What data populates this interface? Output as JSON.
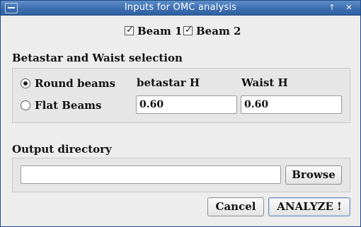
{
  "window": {
    "title": "Inputs for OMC analysis",
    "title_buttons": {
      "menu": "window-menu-icon",
      "up": "↑",
      "close": "✕"
    }
  },
  "beams": {
    "beam1": {
      "label": "Beam 1",
      "checked": true
    },
    "beam2": {
      "label": "Beam 2",
      "checked": true
    },
    "check_glyph": "✓"
  },
  "betastar_section": {
    "title": "Betastar and Waist selection",
    "round_label": "Round beams",
    "flat_label": "Flat Beams",
    "selected": "round",
    "betastar_head": "betastar H",
    "waist_head": "Waist H",
    "betastar_value": "0.60",
    "waist_value": "0.60"
  },
  "output_section": {
    "title": "Output directory",
    "path_value": "",
    "browse_label": "Browse"
  },
  "actions": {
    "cancel_label": "Cancel",
    "analyze_label": "ANALYZE !"
  },
  "colors": {
    "titlebar": "#3d6fb0",
    "background": "#ededed",
    "group_bg": "#e6e6e6"
  }
}
